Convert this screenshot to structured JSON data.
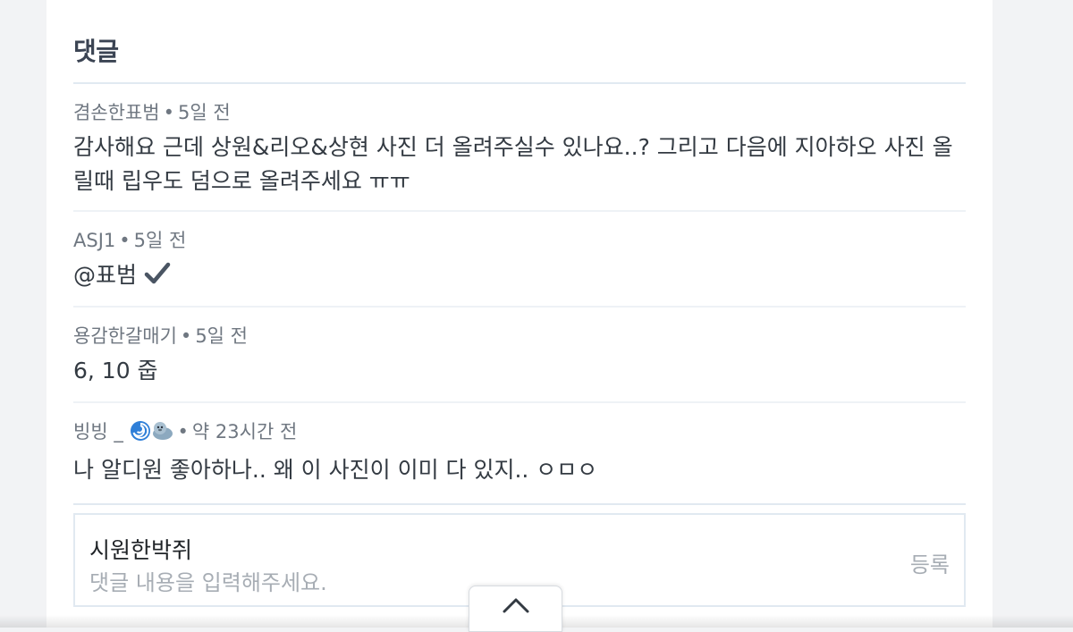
{
  "comments_section": {
    "title": "댓글",
    "comments": [
      {
        "author": "겸손한표범",
        "time": "5일 전",
        "body": "감사해요 근데 상원&리오&상현 사진 더 올려주실수 있나요..? 그리고 다음에 지아하오 사진 올릴때 립우도 덤으로 올려주세요 ㅠㅠ"
      },
      {
        "author": "ASJ1",
        "time": "5일 전",
        "body": "@표범",
        "emoji": "✔️"
      },
      {
        "author": "용감한갈매기",
        "time": "5일 전",
        "body": "6, 10 줍"
      },
      {
        "author": "빙빙 _",
        "author_emojis": [
          "🌀",
          "🦭"
        ],
        "time": "약 23시간 전",
        "body": "나 알디원 좋아하나.. 왜 이 사진이 이미 다 있지.. ㅇㅁㅇ"
      }
    ],
    "separator": "•"
  },
  "comment_input": {
    "author": "시원한박쥐",
    "placeholder": "댓글 내용을 입력해주세요.",
    "submit_label": "등록"
  },
  "scroll_top_button": {
    "icon": "chevron-up-icon"
  },
  "colors": {
    "title": "#3b4453",
    "meta": "#6f7781",
    "body": "#333a42",
    "divider": "#e1e9f1",
    "placeholder": "#a7adb4"
  }
}
